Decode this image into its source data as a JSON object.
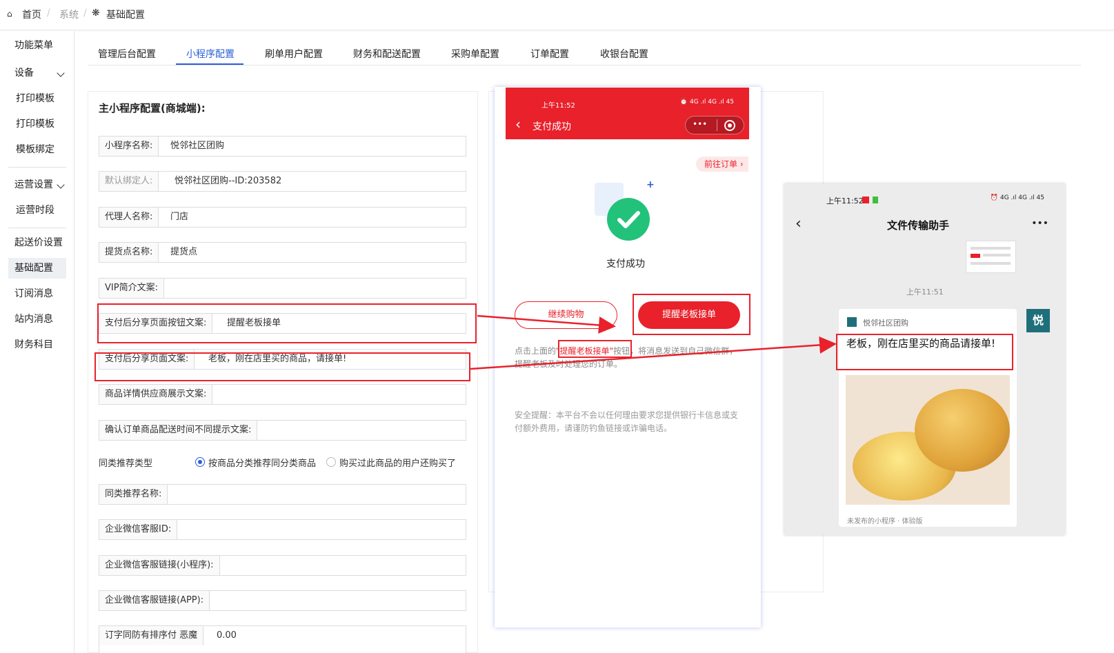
{
  "breadcrumb": {
    "home": "首页",
    "system": "系统",
    "current": "基础配置"
  },
  "sidebar": {
    "items": [
      {
        "label": "功能菜单"
      },
      {
        "label": "设备"
      },
      {
        "label": "打印模板"
      },
      {
        "label": "打印模板"
      },
      {
        "label": "模板绑定"
      },
      {
        "label": "运营设置"
      },
      {
        "label": "运营时段"
      },
      {
        "label": "起送价设置"
      },
      {
        "label": "基础配置"
      },
      {
        "label": "订阅消息"
      },
      {
        "label": "站内消息"
      },
      {
        "label": "财务科目"
      }
    ]
  },
  "tabs": [
    {
      "label": "管理后台配置"
    },
    {
      "label": "小程序配置"
    },
    {
      "label": "刷单用户配置"
    },
    {
      "label": "财务和配送配置"
    },
    {
      "label": "采购单配置"
    },
    {
      "label": "订单配置"
    },
    {
      "label": "收银台配置"
    }
  ],
  "form": {
    "title": "主小程序配置(商城端):",
    "fields": [
      {
        "label": "小程序名称:",
        "value": "悦邻社区团购"
      },
      {
        "label": "默认绑定人:",
        "value": "悦邻社区团购--ID:203582"
      },
      {
        "label": "代理人名称:",
        "value": "门店"
      },
      {
        "label": "提货点名称:",
        "value": "提货点"
      },
      {
        "label": "VIP简介文案:",
        "value": ""
      },
      {
        "label": "支付后分享页面按钮文案:",
        "value": "提醒老板接单"
      },
      {
        "label": "支付后分享页面文案:",
        "value": "老板，刚在店里买的商品，请接单!"
      },
      {
        "label": "商品详情供应商展示文案:",
        "value": ""
      },
      {
        "label": "确认订单商品配送时间不同提示文案:",
        "value": ""
      },
      {
        "label": "同类推荐名称:",
        "value": ""
      },
      {
        "label": "企业微信客服ID:",
        "value": ""
      },
      {
        "label": "企业微信客服链接(小程序):",
        "value": ""
      },
      {
        "label": "企业微信客服链接(APP):",
        "value": ""
      },
      {
        "label": "订字同防有排序付 恶魔",
        "value": "0.00"
      }
    ],
    "recommend": {
      "label": "同类推荐类型",
      "option1": "按商品分类推荐同分类商品",
      "option2": "购买过此商品的用户还购买了"
    }
  },
  "phone": {
    "time": "上午11:52",
    "status_icons": "⏰ 4G .ıl 4G .ıl 45",
    "title": "支付成功",
    "back": "‹",
    "more": "•••",
    "goto_orders": "前往订单 ›",
    "success_text": "支付成功",
    "continue_btn": "继续购物",
    "remind_btn": "提醒老板接单",
    "tip_prefix": "点击上面的",
    "tip_highlight": "\"提醒老板接单\"",
    "tip_suffix": "按钮，将消息发送到自己微信群，提醒老板及时处理您的订单。",
    "security": "安全提醒：本平台不会以任何理由要求您提供银行卡信息或支付额外费用，请谨防钓鱼链接或诈骗电话。"
  },
  "chat": {
    "time": "上午11:52",
    "title": "文件传输助手",
    "more": "•••",
    "msg_time": "上午11:51",
    "source": "悦邻社区团购",
    "message": "老板，刚在店里买的商品请接单!",
    "footer": "未发布的小程序 · 体验版",
    "avatar": "悦"
  },
  "colors": {
    "accent": "#2a5fd6",
    "red": "#e8212b",
    "green": "#22c27b"
  }
}
